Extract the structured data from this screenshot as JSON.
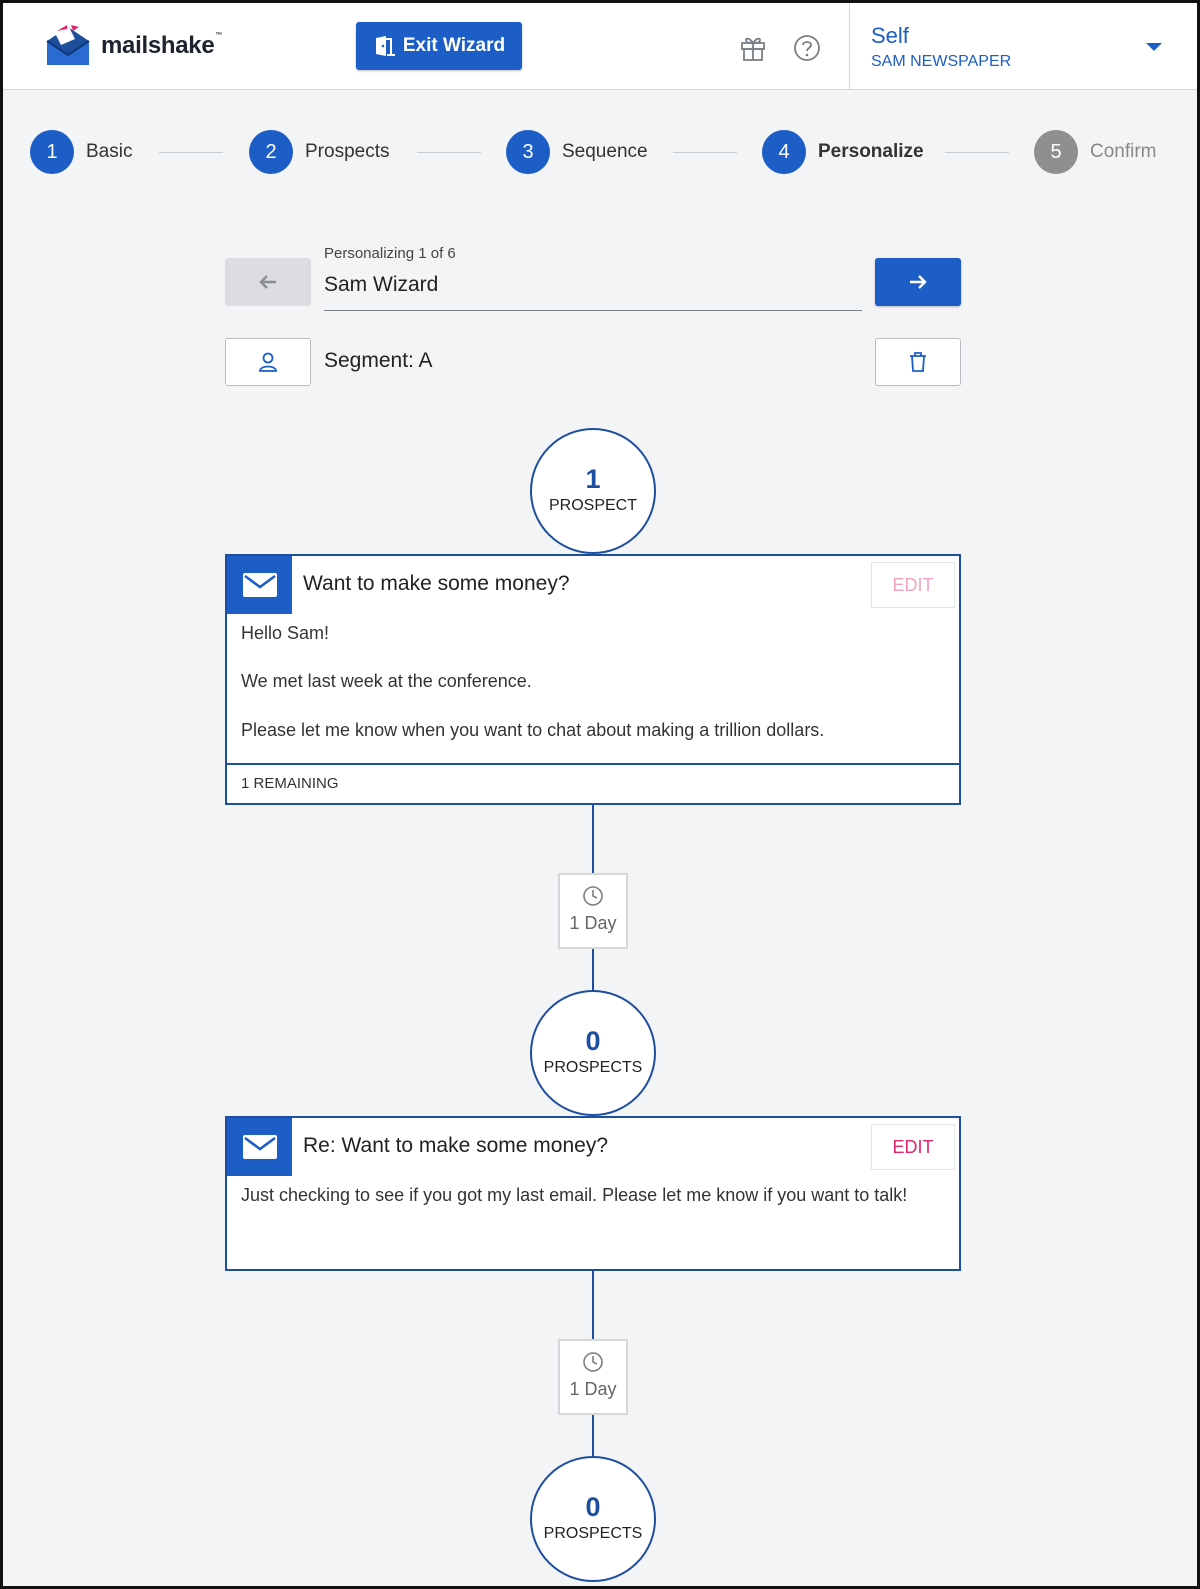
{
  "header": {
    "brand": "mailshake",
    "brand_tm": "™",
    "exit_label": "Exit Wizard",
    "account": {
      "name": "Self",
      "org": "SAM NEWSPAPER"
    }
  },
  "stepper": [
    {
      "num": "1",
      "label": "Basic",
      "state": "done"
    },
    {
      "num": "2",
      "label": "Prospects",
      "state": "done"
    },
    {
      "num": "3",
      "label": "Sequence",
      "state": "done"
    },
    {
      "num": "4",
      "label": "Personalize",
      "state": "current"
    },
    {
      "num": "5",
      "label": "Confirm",
      "state": "upcoming"
    }
  ],
  "personalize": {
    "caption": "Personalizing 1 of 6",
    "name": "Sam Wizard",
    "segment": "Segment: A"
  },
  "flow": {
    "nodes": [
      {
        "count": "1",
        "label": "PROSPECT"
      },
      {
        "count": "0",
        "label": "PROSPECTS"
      },
      {
        "count": "0",
        "label": "PROSPECTS"
      }
    ],
    "messages": [
      {
        "subject": "Want to make some money?",
        "edit_label": "EDIT",
        "edit_state": "faded",
        "body": [
          "Hello Sam!",
          "We met last week at the conference.",
          "Please let me know when you want to chat about making a trillion dollars."
        ],
        "footer": "1 REMAINING"
      },
      {
        "subject": "Re: Want to make some money?",
        "edit_label": "EDIT",
        "edit_state": "active",
        "body": [
          "Just checking to see if you got my last email. Please let me know if you want to talk!"
        ]
      }
    ],
    "delays": [
      {
        "label": "1 Day"
      },
      {
        "label": "1 Day"
      }
    ]
  },
  "colors": {
    "primary": "#1d5ec6",
    "line": "#1d4ea0",
    "edit_active": "#e2266d",
    "edit_faded": "#f2a3c0",
    "step_upcoming": "#8f8f8f"
  }
}
